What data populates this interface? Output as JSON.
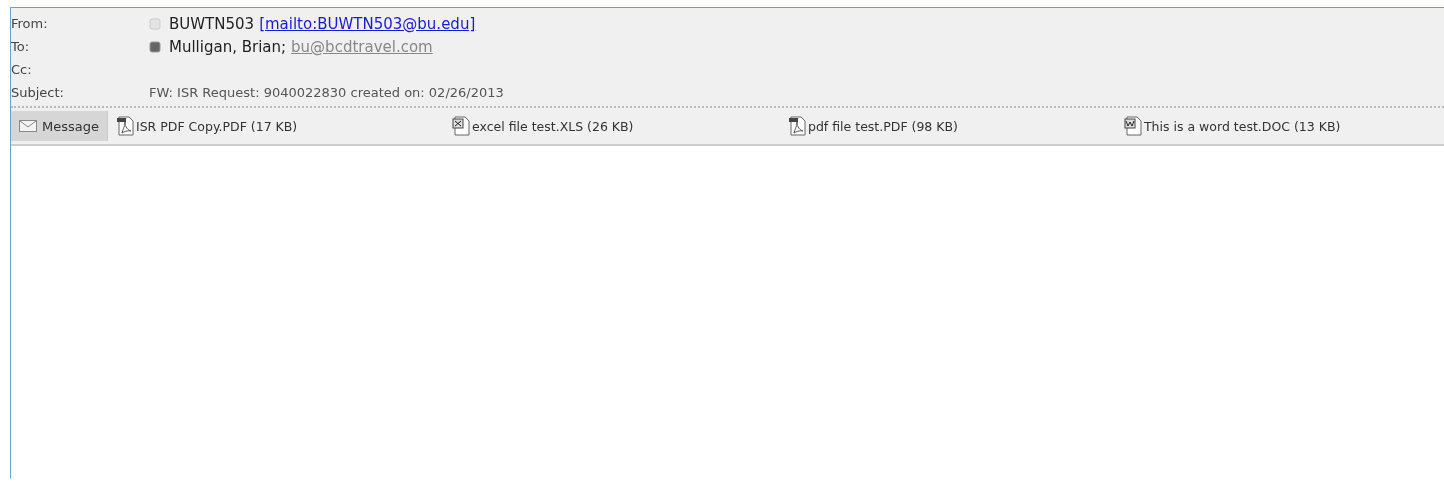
{
  "header": {
    "from": {
      "label": "From:",
      "name": "BUWTN503",
      "link": "[mailto:BUWTN503@bu.edu]"
    },
    "to": {
      "label": "To:",
      "name": "Mulligan, Brian;",
      "link": "bu@bcdtravel.com"
    },
    "cc": {
      "label": "Cc:"
    },
    "subject": {
      "label": "Subject:",
      "value": "FW: ISR Request: 9040022830 created on: 02/26/2013"
    }
  },
  "tabs": [
    {
      "label": "Message",
      "selected": true
    }
  ],
  "attachments": [
    {
      "kind": "pdf",
      "label": "ISR PDF Copy.PDF (17 KB)"
    },
    {
      "kind": "excel",
      "label": "excel file test.XLS (26 KB)"
    },
    {
      "kind": "pdf",
      "label": "pdf file test.PDF (98 KB)"
    },
    {
      "kind": "word",
      "label": "This is a word test.DOC (13 KB)"
    }
  ]
}
